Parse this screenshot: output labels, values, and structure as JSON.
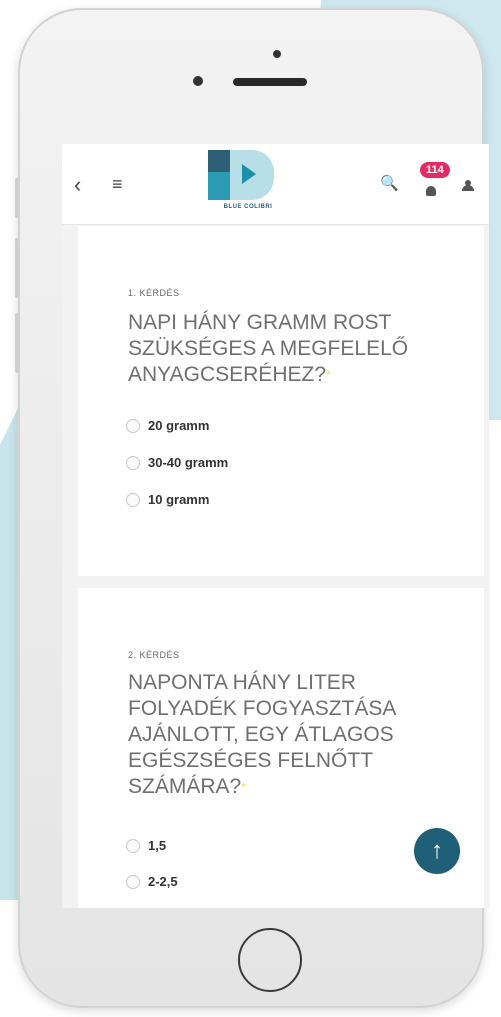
{
  "header": {
    "brand": "BLUE COLIBRI",
    "notification_count": "114"
  },
  "icons": {
    "back": "back-icon",
    "menu": "menu-icon",
    "search": "search-icon",
    "bell": "bell-icon",
    "user": "user-icon",
    "scroll_top": "arrow-up-icon"
  },
  "questions": [
    {
      "label": "1. KÉRDÉS",
      "text": "NAPI HÁNY GRAMM ROST SZÜKSÉGES A MEGFELELŐ ANYAGCSERÉHEZ?",
      "required_mark": "*",
      "options": [
        "20 gramm",
        "30-40 gramm",
        "10 gramm"
      ]
    },
    {
      "label": "2. KÉRDÉS",
      "text": "NAPONTA HÁNY LITER FOLYADÉK FOGYASZTÁSA AJÁNLOTT, EGY ÁTLAGOS EGÉSZSÉGES FELNŐTT SZÁMÁRA?",
      "required_mark": "*",
      "options": [
        "1,5",
        "2-2,5"
      ]
    }
  ],
  "colors": {
    "accent": "#1f5f78",
    "badge": "#e22c63",
    "background_shape": "#cfe7ee"
  }
}
